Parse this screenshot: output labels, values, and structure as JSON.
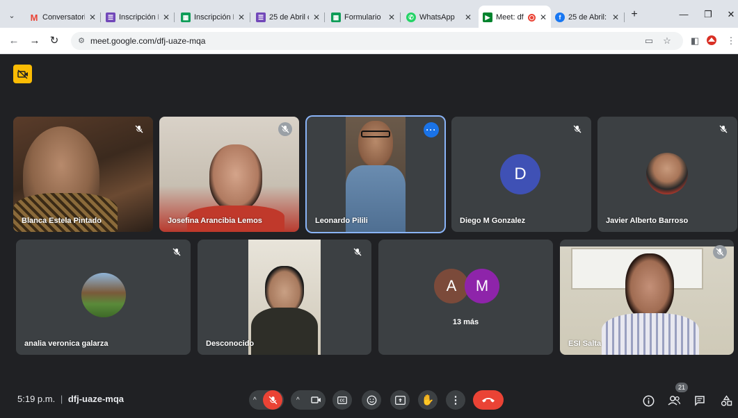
{
  "browser": {
    "tabs": [
      {
        "title": "Conversatori",
        "icon": "gmail-icon",
        "color": "#ea4335"
      },
      {
        "title": "Inscripción F",
        "icon": "forms-icon",
        "color": "#7248b9"
      },
      {
        "title": "Inscripción F",
        "icon": "sheets-icon",
        "color": "#0f9d58"
      },
      {
        "title": "25 de Abril c",
        "icon": "forms-icon",
        "color": "#7248b9"
      },
      {
        "title": "Formulario",
        "icon": "sheets-icon",
        "color": "#0f9d58"
      },
      {
        "title": "WhatsApp",
        "icon": "whatsapp-icon",
        "color": "#25d366"
      },
      {
        "title": "Meet: df",
        "icon": "meet-icon",
        "color": "#00832d",
        "active": true
      },
      {
        "title": "25 de Abril:",
        "icon": "facebook-icon",
        "color": "#1877f2"
      }
    ],
    "new_tab_label": "+",
    "window_controls": {
      "minimize": "—",
      "maximize": "❐",
      "close": "✕"
    },
    "url": "meet.google.com/dfj-uaze-mqa"
  },
  "meet": {
    "participants_row1": [
      {
        "name": "Blanca Estela Pintado",
        "muted": true,
        "kind": "video"
      },
      {
        "name": "Josefina Arancibia Lemos",
        "muted": true,
        "kind": "video"
      },
      {
        "name": "Leonardo Pilili",
        "speaking": true,
        "kind": "video"
      },
      {
        "name": "Diego M Gonzalez",
        "muted": true,
        "kind": "letter",
        "letter": "D",
        "avatar_color": "#3f51b5"
      },
      {
        "name": "Javier Alberto Barroso",
        "muted": true,
        "kind": "photo"
      }
    ],
    "participants_row2": [
      {
        "name": "analia veronica galarza",
        "muted": true,
        "kind": "photo"
      },
      {
        "name": "Desconocido",
        "muted": true,
        "kind": "video"
      },
      {
        "name": "",
        "kind": "overflow",
        "letters": [
          "A",
          "M"
        ],
        "letter_colors": [
          "#7b4a3a",
          "#8e24aa"
        ],
        "more_text": "13 más"
      },
      {
        "name": "ESI Salta",
        "muted": true,
        "kind": "video"
      }
    ],
    "time": "5:19 p.m.",
    "separator": "|",
    "meeting_code": "dfj-uaze-mqa",
    "participant_count": "21",
    "colors": {
      "end_call": "#ea4335",
      "speaker_outline": "#8ab4f8",
      "camera_warning": "#fbbc04"
    }
  }
}
